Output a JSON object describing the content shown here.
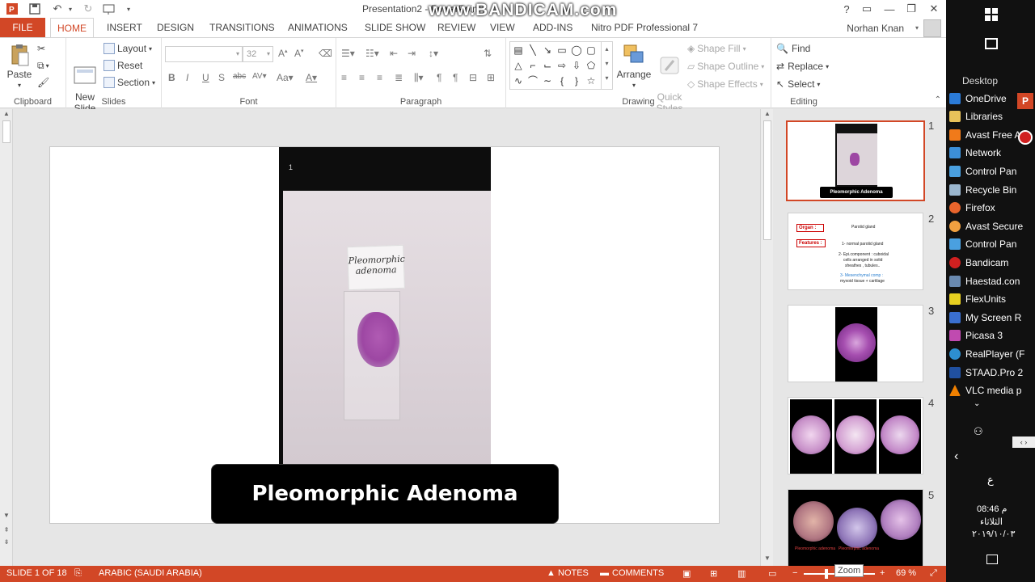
{
  "window": {
    "title": "Presentation2 - PowerPoint",
    "watermark": "www.BANDICAM.com",
    "user": "Norhan Knan"
  },
  "tabs": [
    "FILE",
    "HOME",
    "INSERT",
    "DESIGN",
    "TRANSITIONS",
    "ANIMATIONS",
    "SLIDE SHOW",
    "REVIEW",
    "VIEW",
    "ADD-INS",
    "Nitro PDF Professional 7"
  ],
  "ribbon": {
    "clipboard": {
      "label": "Clipboard",
      "paste": "Paste"
    },
    "slides": {
      "label": "Slides",
      "new_slide": "New\nSlide",
      "layout": "Layout",
      "reset": "Reset",
      "section": "Section"
    },
    "font": {
      "label": "Font",
      "size": "32"
    },
    "paragraph": {
      "label": "Paragraph"
    },
    "drawing": {
      "label": "Drawing",
      "arrange": "Arrange",
      "quick_styles": "Quick\nStyles",
      "shape_fill": "Shape Fill",
      "shape_outline": "Shape Outline",
      "shape_effects": "Shape Effects"
    },
    "editing": {
      "label": "Editing",
      "find": "Find",
      "replace": "Replace",
      "select": "Select"
    }
  },
  "slide": {
    "photo_number": "1",
    "label_text": "Pleomorphic\nadenoma",
    "caption": "Pleomorphic Adenoma"
  },
  "thumbnails": [
    {
      "num": "1",
      "caption": "Pleomorphic Adenoma"
    },
    {
      "num": "2",
      "organ_label": "Organ :",
      "organ_value": "Parotid gland",
      "features_label": "Features :",
      "f1": "1- normal parotid gland",
      "f2a": "2- Epi.component : cuboidal",
      "f2b": "cells arranged in solid",
      "f2c": "sheathes , tubules..",
      "f3a": "3- Mesenchymal comp :",
      "f3b": "myxoid tissue + cartilage"
    },
    {
      "num": "3"
    },
    {
      "num": "4"
    },
    {
      "num": "5",
      "caption_a": "Pleomorphic adenoma",
      "caption_b": "Pleomorphic adenoma"
    }
  ],
  "statusbar": {
    "slide_info": "SLIDE 1 OF 18",
    "language": "ARABIC (SAUDI ARABIA)",
    "notes": "NOTES",
    "comments": "COMMENTS",
    "zoom": "69 %",
    "zoom_tooltip": "Zoom"
  },
  "desktop": {
    "header": "Desktop",
    "items": [
      "OneDrive",
      "Libraries",
      "Avast Free A",
      "Network",
      "Control Pan",
      "Recycle Bin",
      "Firefox",
      "Avast Secure",
      "Control Pan",
      "Bandicam",
      "Haestad.con",
      "FlexUnits",
      "My Screen R",
      "Picasa 3",
      "RealPlayer (F",
      "STAAD.Pro 2",
      "VLC media p"
    ],
    "lang": "ع",
    "time": "08:46 م",
    "day": "الثلاثاء",
    "date": "٢٠١٩/١٠/٠٣"
  },
  "colors": {
    "accent": "#d24726",
    "taskbar": "#111111"
  }
}
